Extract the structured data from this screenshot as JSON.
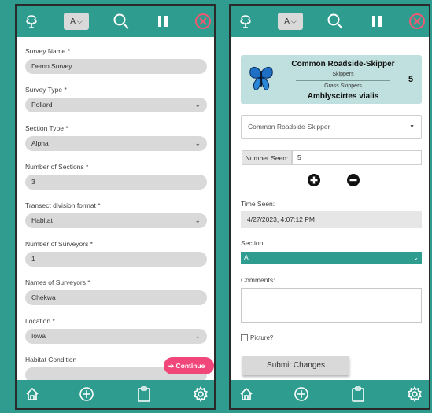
{
  "toolbar": {
    "font_size_label": "A",
    "font_size_chevron": "⌵",
    "accent_color": "#2e9c8e",
    "close_color": "#ee5a73",
    "icons": [
      "tree-icon",
      "search-icon",
      "pause-icon",
      "close-icon"
    ]
  },
  "left": {
    "fields": [
      {
        "label": "Survey Name *",
        "value": "Demo Survey",
        "dropdown": false
      },
      {
        "label": "Survey Type *",
        "value": "Pollard",
        "dropdown": true
      },
      {
        "label": "Section Type *",
        "value": "Alpha",
        "dropdown": true
      },
      {
        "label": "Number of Sections *",
        "value": "3",
        "dropdown": false
      },
      {
        "label": "Transect division format *",
        "value": "Habitat",
        "dropdown": true
      },
      {
        "label": "Number of Surveyors *",
        "value": "1",
        "dropdown": false
      },
      {
        "label": "Names of Surveyors *",
        "value": "Chekwa",
        "dropdown": false
      },
      {
        "label": "Location *",
        "value": "Iowa",
        "dropdown": true
      },
      {
        "label": "Habitat Condition",
        "value": "",
        "dropdown": false
      }
    ],
    "continue_label": "Continue",
    "continue_color": "#f0467a"
  },
  "right": {
    "species": {
      "common_name": "Common Roadside-Skipper",
      "family": "Skippers",
      "subfamily": "Grass Skippers",
      "scientific_name": "Amblyscirtes vialis",
      "count": "5"
    },
    "species_select": "Common Roadside-Skipper",
    "number_seen_label": "Number Seen:",
    "number_seen_value": "5",
    "time_seen_label": "Time Seen:",
    "time_seen_value": "4/27/2023, 4:07:12 PM",
    "section_label": "Section:",
    "section_value": "A",
    "comments_label": "Comments:",
    "picture_label": "Picture?",
    "submit_label": "Submit Changes"
  },
  "bottom_nav": [
    "home-icon",
    "add-circle-icon",
    "clipboard-icon",
    "settings-gear-icon"
  ]
}
